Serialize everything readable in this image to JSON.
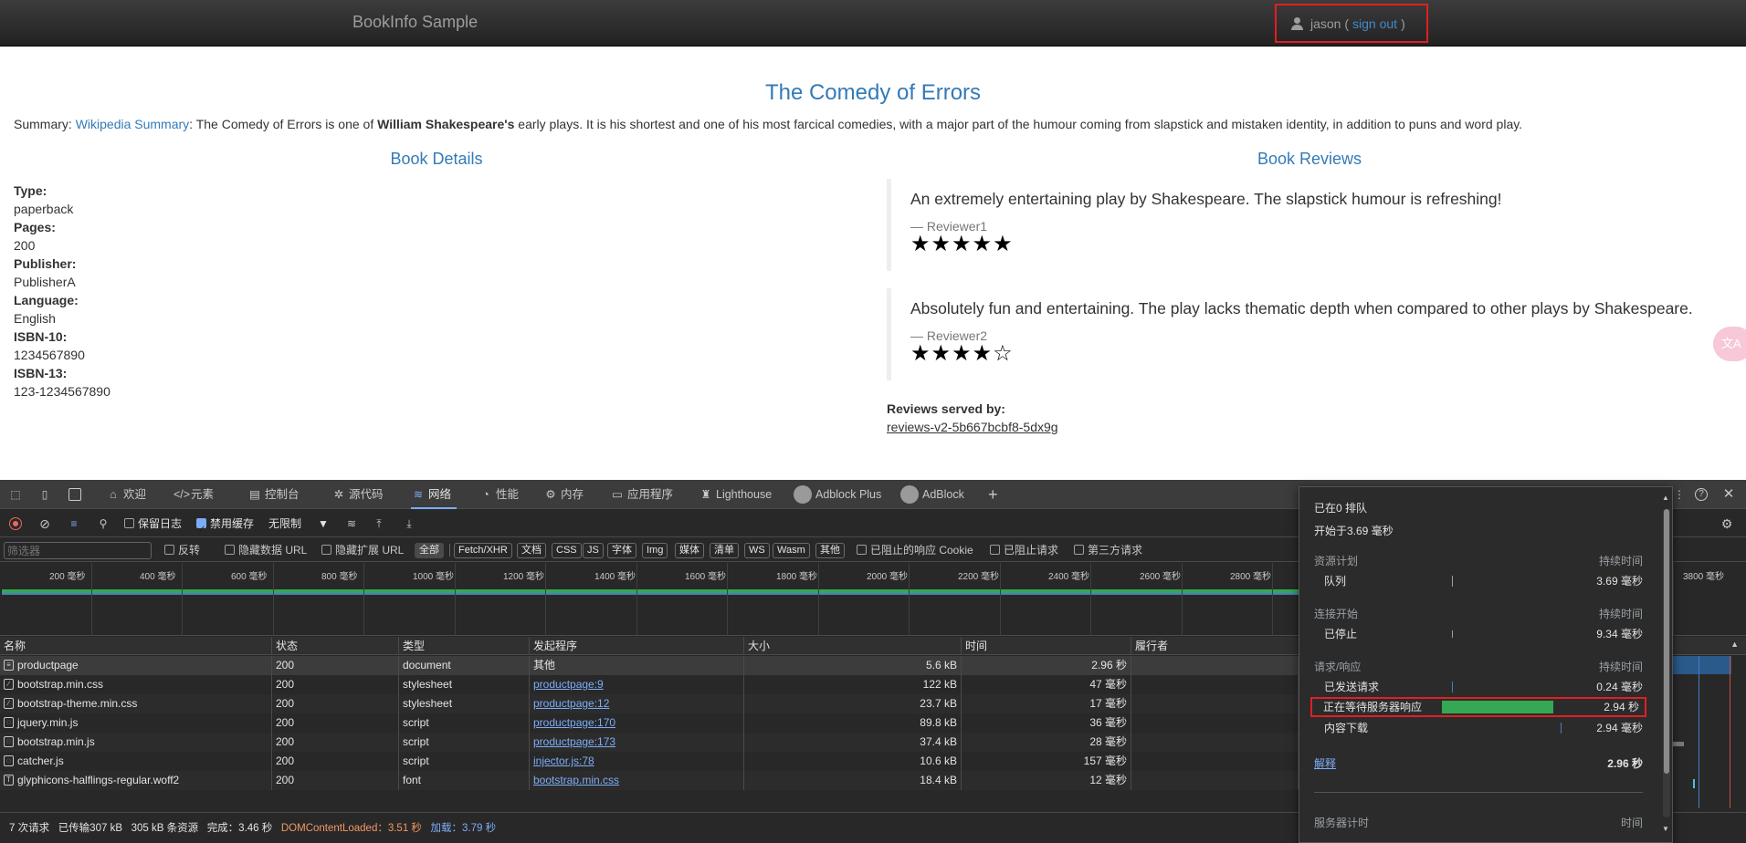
{
  "navbar": {
    "brand": "BookInfo Sample",
    "user": "jason (",
    "signout": "sign out",
    "user_close": ")"
  },
  "book": {
    "title": "The Comedy of Errors",
    "summary_label": "Summary: ",
    "summary_link": "Wikipedia Summary",
    "summary_text_1": ": The Comedy of Errors is one of ",
    "summary_bold": "William Shakespeare's",
    "summary_text_2": " early plays. It is his shortest and one of his most farcical comedies, with a major part of the humour coming from slapstick and mistaken identity, in addition to puns and word play."
  },
  "details": {
    "heading": "Book Details",
    "items": [
      {
        "label": "Type:",
        "value": "paperback"
      },
      {
        "label": "Pages:",
        "value": "200"
      },
      {
        "label": "Publisher:",
        "value": "PublisherA"
      },
      {
        "label": "Language:",
        "value": "English"
      },
      {
        "label": "ISBN-10:",
        "value": "1234567890"
      },
      {
        "label": "ISBN-13:",
        "value": "123-1234567890"
      }
    ]
  },
  "reviews": {
    "heading": "Book Reviews",
    "items": [
      {
        "text": "An extremely entertaining play by Shakespeare. The slapstick humour is refreshing!",
        "reviewer": "— Reviewer1",
        "stars": "★★★★★"
      },
      {
        "text": "Absolutely fun and entertaining. The play lacks thematic depth when compared to other plays by Shakespeare.",
        "reviewer": "— Reviewer2",
        "stars": "★★★★☆"
      }
    ],
    "served_label": "Reviews served by:",
    "served_pod": "reviews-v2-5b667bcbf8-5dx9g"
  },
  "translate_bubble": "文A",
  "devtools": {
    "tabs": [
      {
        "label": "欢迎",
        "icon": "home-icon"
      },
      {
        "label": "元素",
        "icon": "code-icon"
      },
      {
        "label": "控制台",
        "icon": "console-icon"
      },
      {
        "label": "源代码",
        "icon": "bug-icon"
      },
      {
        "label": "网络",
        "icon": "wifi-icon"
      },
      {
        "label": "性能",
        "icon": "gauge-icon"
      },
      {
        "label": "内存",
        "icon": "memory-icon"
      },
      {
        "label": "应用程序",
        "icon": "app-icon"
      },
      {
        "label": "Lighthouse",
        "icon": "lighthouse-icon"
      },
      {
        "label": "Adblock Plus",
        "icon": "adblock-plus-icon"
      },
      {
        "label": "AdBlock",
        "icon": "adblock-icon"
      }
    ],
    "active_tab": "网络",
    "toolbar": {
      "preserve_log": "保留日志",
      "disable_cache": "禁用缓存",
      "throttle": "无限制"
    },
    "filter": {
      "placeholder": "筛选器",
      "invert": "反转",
      "hide_data_urls": "隐藏数据 URL",
      "hide_ext_urls": "隐藏扩展 URL",
      "chips": [
        "全部",
        "Fetch/XHR",
        "文档",
        "CSS",
        "JS",
        "字体",
        "Img",
        "媒体",
        "清单",
        "WS",
        "Wasm",
        "其他"
      ],
      "active_chip": "全部",
      "blocked_cookies": "已阻止的响应 Cookie",
      "blocked_requests": "已阻止请求",
      "third_party": "第三方请求"
    },
    "overview_ticks": [
      "200 毫秒",
      "400 毫秒",
      "600 毫秒",
      "800 毫秒",
      "1000 毫秒",
      "1200 毫秒",
      "1400 毫秒",
      "1600 毫秒",
      "1800 毫秒",
      "2000 毫秒",
      "2200 毫秒",
      "2400 毫秒",
      "2600 毫秒",
      "2800 毫秒"
    ],
    "overview_right_tick": "3800 毫秒",
    "columns": [
      "名称",
      "状态",
      "类型",
      "发起程序",
      "大小",
      "时间",
      "履行者"
    ],
    "rows": [
      {
        "name": "productpage",
        "icon": "document-icon",
        "status": "200",
        "type": "document",
        "initiator": "其他",
        "initiator_link": false,
        "size": "5.6 kB",
        "time": "2.96 秒"
      },
      {
        "name": "bootstrap.min.css",
        "icon": "stylesheet-icon",
        "status": "200",
        "type": "stylesheet",
        "initiator": "productpage:9",
        "initiator_link": true,
        "size": "122 kB",
        "time": "47 毫秒"
      },
      {
        "name": "bootstrap-theme.min.css",
        "icon": "stylesheet-icon",
        "status": "200",
        "type": "stylesheet",
        "initiator": "productpage:12",
        "initiator_link": true,
        "size": "23.7 kB",
        "time": "17 毫秒"
      },
      {
        "name": "jquery.min.js",
        "icon": "script-icon",
        "status": "200",
        "type": "script",
        "initiator": "productpage:170",
        "initiator_link": true,
        "size": "89.8 kB",
        "time": "36 毫秒"
      },
      {
        "name": "bootstrap.min.js",
        "icon": "script-icon",
        "status": "200",
        "type": "script",
        "initiator": "productpage:173",
        "initiator_link": true,
        "size": "37.4 kB",
        "time": "28 毫秒"
      },
      {
        "name": "catcher.js",
        "icon": "script-icon",
        "status": "200",
        "type": "script",
        "initiator": "injector.js:78",
        "initiator_link": true,
        "size": "10.6 kB",
        "time": "157 毫秒"
      },
      {
        "name": "glyphicons-halflings-regular.woff2",
        "icon": "font-icon",
        "status": "200",
        "type": "font",
        "initiator": "bootstrap.min.css",
        "initiator_link": true,
        "size": "18.4 kB",
        "time": "12 毫秒"
      }
    ],
    "status_bar": {
      "requests": "7 次请求",
      "transferred": "已传输307 kB",
      "resources": "305 kB 条资源",
      "finish": "完成：3.46 秒",
      "dcl": "DOMContentLoaded：3.51 秒",
      "load": "加载：3.79 秒"
    },
    "timing": {
      "queued": "已在0 排队",
      "started": "开始于3.69 毫秒",
      "sections": [
        {
          "title": "资源计划",
          "duration_label": "持续时间",
          "rows": [
            {
              "name": "队列",
              "value": "3.69 毫秒"
            }
          ]
        },
        {
          "title": "连接开始",
          "duration_label": "持续时间",
          "rows": [
            {
              "name": "已停止",
              "value": "9.34 毫秒"
            }
          ]
        },
        {
          "title": "请求/响应",
          "duration_label": "持续时间",
          "rows": [
            {
              "name": "已发送请求",
              "value": "0.24 毫秒"
            },
            {
              "name": "正在等待服务器响应",
              "value": "2.94 秒"
            },
            {
              "name": "内容下载",
              "value": "2.94 毫秒"
            }
          ]
        }
      ],
      "explanation": "解释",
      "total": "2.96 秒",
      "server_timing": "服务器计时",
      "server_timing_duration": "时间"
    }
  }
}
